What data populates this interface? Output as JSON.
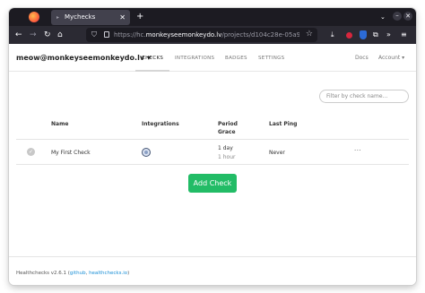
{
  "browser": {
    "tab_title": "Mychecks",
    "tab_close": "✕",
    "new_tab": "+",
    "url_prefix": "https://hc.",
    "url_host": "monkeyseemonkeydo.lv",
    "url_path": "/projects/d104c28e-05a9-4",
    "list_all_tabs": "»"
  },
  "app": {
    "brand": "meow@monkeyseemonkeydo.lv",
    "brand_caret": "▾",
    "nav": [
      "CHECKS",
      "INTEGRATIONS",
      "BADGES",
      "SETTINGS"
    ],
    "docs": "Docs",
    "account": "Account",
    "account_caret": "▾",
    "filter_placeholder": "Filter by check name...",
    "columns": {
      "name": "Name",
      "integrations": "Integrations",
      "period": "Period",
      "grace": "Grace",
      "last_ping": "Last Ping"
    },
    "checks": [
      {
        "name": "My First Check",
        "period": "1 day",
        "grace": "1 hour",
        "last_ping": "Never",
        "menu": "···"
      }
    ],
    "add_check_label": "Add Check",
    "footer": {
      "version": "Healthchecks v2.6.1 (",
      "github": "github",
      "separator": ", ",
      "site": "healthchecks.io",
      "close": ")"
    }
  },
  "icons": {
    "firefox": "firefox-logo-icon",
    "back": "back-arrow-icon",
    "forward": "forward-arrow-icon",
    "reload": "reload-icon",
    "home": "home-icon",
    "shield": "tracking-shield-icon",
    "lock": "padlock-icon",
    "star": "bookmark-star-icon",
    "download": "download-icon",
    "extension_red": "red-extension-icon",
    "extension_blue": "blue-extension-icon",
    "extensions": "puzzle-icon",
    "menu": "hamburger-menu-icon",
    "check_status": "check-status-icon",
    "integration": "email-integration-icon"
  },
  "colors": {
    "accent_green": "#22bc66",
    "link_blue": "#1a8fd6",
    "browser_dark": "#1c1b22"
  }
}
